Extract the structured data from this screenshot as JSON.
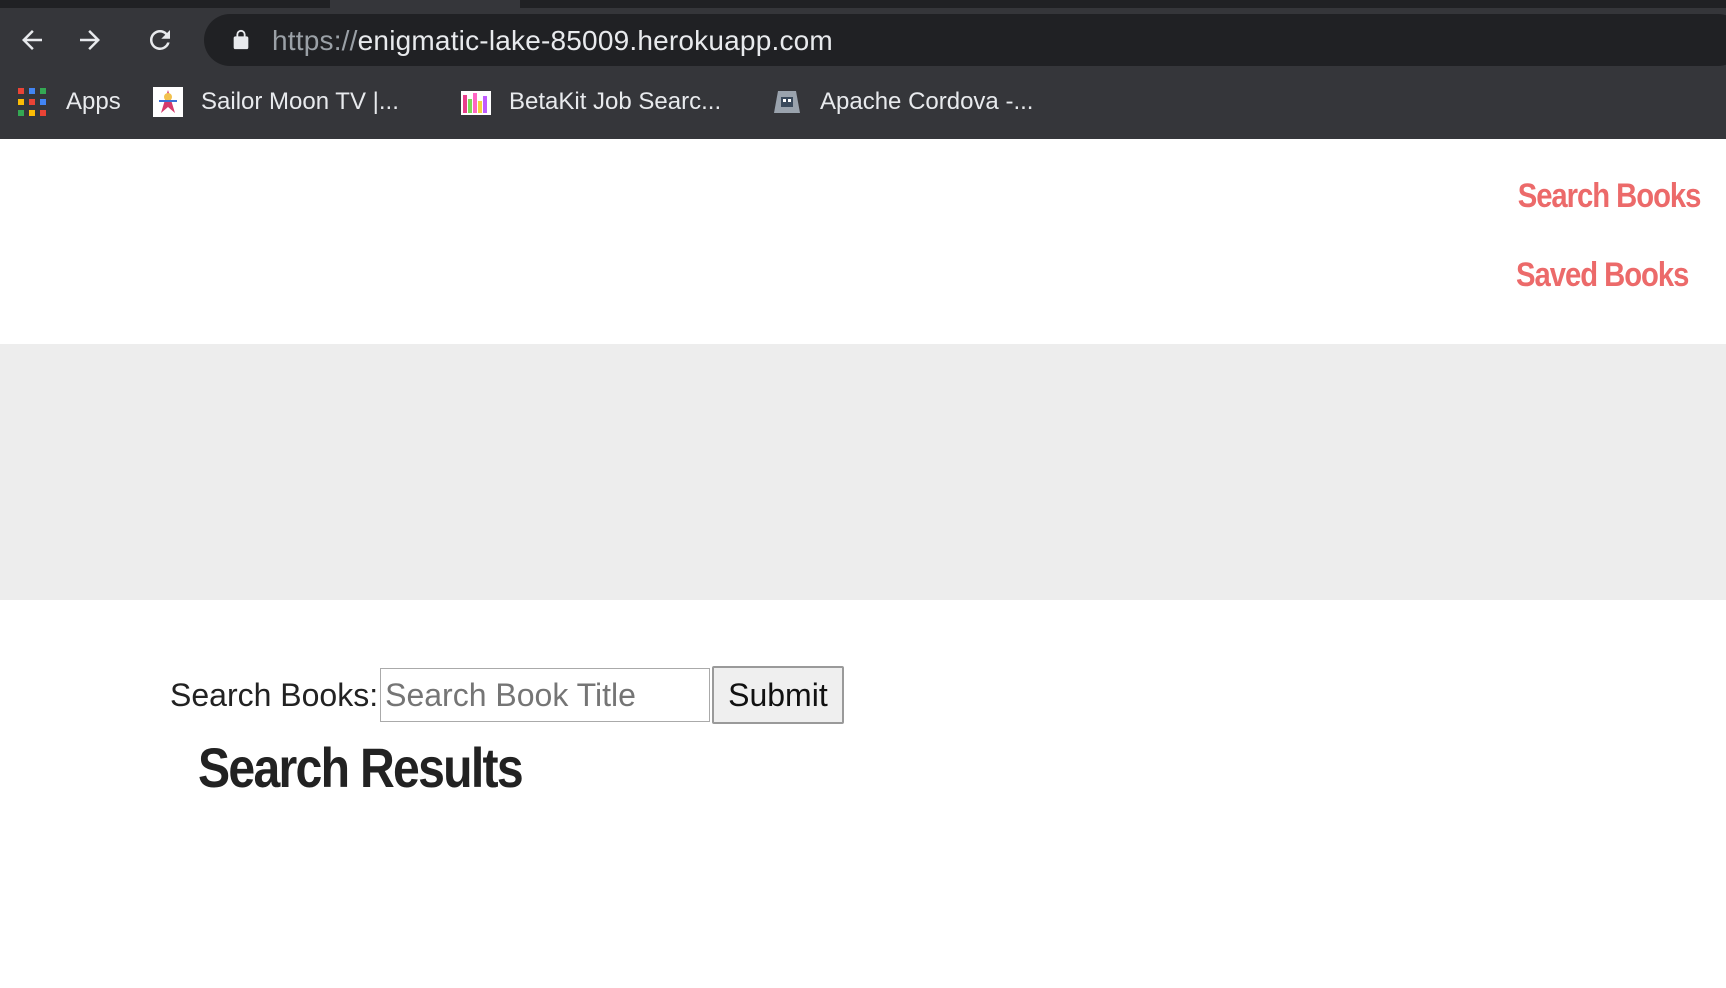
{
  "browser": {
    "url_scheme": "https://",
    "url_host": "enigmatic-lake-85009.herokuapp.com",
    "bookmarks": [
      {
        "label": "Apps",
        "icon": "apps-grid-icon"
      },
      {
        "label": "Sailor Moon TV |...",
        "icon": "sailor-moon-favicon"
      },
      {
        "label": "BetaKit Job Searc...",
        "icon": "betakit-favicon"
      },
      {
        "label": "Apache Cordova -...",
        "icon": "cordova-favicon"
      }
    ]
  },
  "nav": {
    "links": [
      {
        "label": "Search Books"
      },
      {
        "label": "Saved Books"
      }
    ],
    "link_color": "#ec6a6a"
  },
  "jumbotron": {
    "background": "#ededed"
  },
  "search": {
    "label": "Search Books:",
    "placeholder": "Search Book Title",
    "value": "",
    "submit_label": "Submit"
  },
  "results": {
    "title": "Search Results",
    "items": []
  }
}
